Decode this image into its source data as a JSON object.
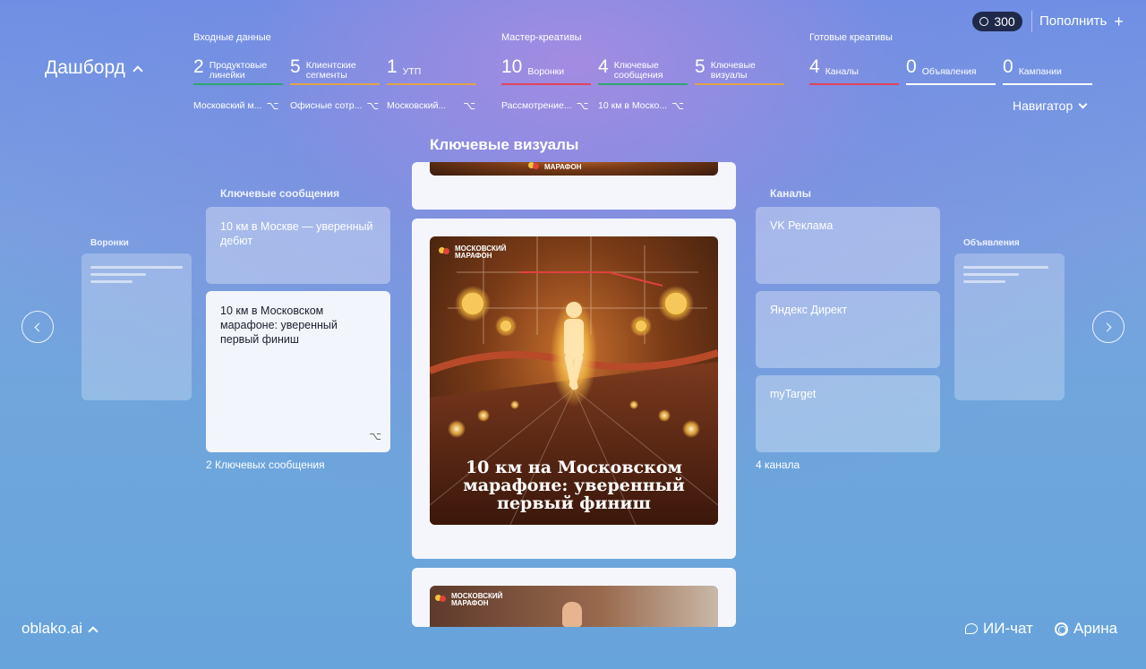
{
  "header": {
    "title": "Дашборд",
    "credits": "300",
    "topup_label": "Пополнить",
    "navigator_label": "Навигатор"
  },
  "groups": {
    "input": {
      "title": "Входные данные",
      "stats": [
        {
          "num": "2",
          "label": "Продуктовые линейки",
          "color": "#2ea66f"
        },
        {
          "num": "5",
          "label": "Клиентские сегменты",
          "color": "#e0a34a"
        },
        {
          "num": "1",
          "label": "УТП",
          "color": "#e0a34a"
        }
      ],
      "chips": [
        "Московский м...",
        "Офисные сотр...",
        "Московский..."
      ]
    },
    "master": {
      "title": "Мастер-креативы",
      "stats": [
        {
          "num": "10",
          "label": "Воронки",
          "color": "#e0445a"
        },
        {
          "num": "4",
          "label": "Ключевые сообщения",
          "color": "#2ea66f"
        },
        {
          "num": "5",
          "label": "Ключевые визуалы",
          "color": "#e0a34a"
        }
      ],
      "chips": [
        "Рассмотрение...",
        "10 км в Моско..."
      ]
    },
    "ready": {
      "title": "Готовые креативы",
      "stats": [
        {
          "num": "4",
          "label": "Каналы",
          "color": "#e0445a"
        },
        {
          "num": "0",
          "label": "Объявления",
          "color": "#ffffff"
        },
        {
          "num": "0",
          "label": "Кампании",
          "color": "#ffffff"
        }
      ]
    }
  },
  "main": {
    "section_title": "Ключевые визуалы",
    "funnels_label": "Воронки",
    "messages_label": "Ключевые сообщения",
    "messages": [
      "10 км в Москве — уверенный дебют",
      "10 км в Московском марафоне: уверенный первый финиш"
    ],
    "messages_count": "2 Ключевых сообщения",
    "channels_label": "Каналы",
    "channels": [
      "VK Реклама",
      "Яндекс Директ",
      "myTarget"
    ],
    "channels_count": "4 канала",
    "ads_label": "Объявления",
    "poster": {
      "brand_line1": "МОСКОВСКИЙ",
      "brand_line2": "МАРАФОН",
      "headline": "10 км на Московском марафоне: уверенный первый финиш"
    }
  },
  "footer": {
    "logo": "oblako.ai",
    "chat_label": "ИИ-чат",
    "user_label": "Арина"
  },
  "colors": {
    "green": "#2ea66f",
    "orange": "#e0a34a",
    "red": "#e0445a",
    "credits_bg": "#1f2a4a"
  }
}
